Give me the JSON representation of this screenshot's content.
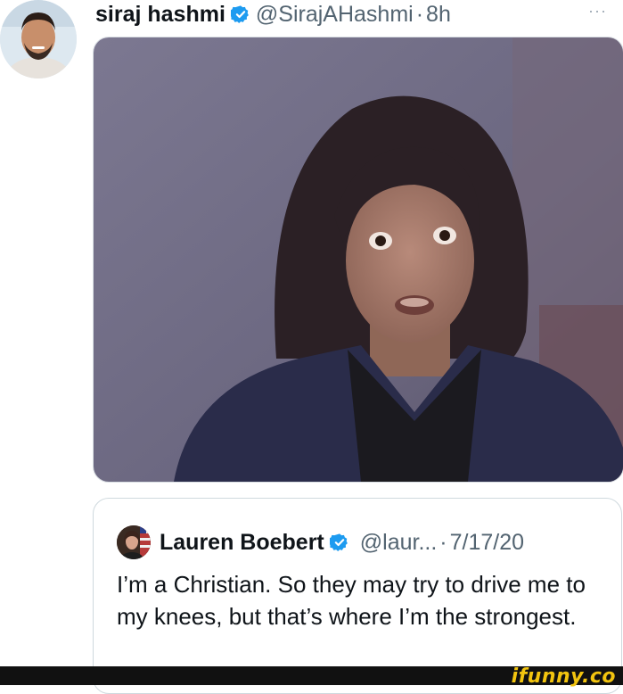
{
  "tweet": {
    "author_name": "siraj hashmi",
    "author_handle": "@SirajAHashmi",
    "separator": "·",
    "time": "8h",
    "more": "···"
  },
  "quoted": {
    "author_name": "Lauren Boebert",
    "author_handle": "@laur...",
    "separator": "·",
    "date": "7/17/20",
    "text": "I’m a Christian. So they may try to drive me to my knees, but that’s where I’m the strongest."
  },
  "watermark": "ifunny.co",
  "colors": {
    "verified": "#1d9bf0",
    "secondary_text": "#536471",
    "watermark": "#f2c40f"
  }
}
